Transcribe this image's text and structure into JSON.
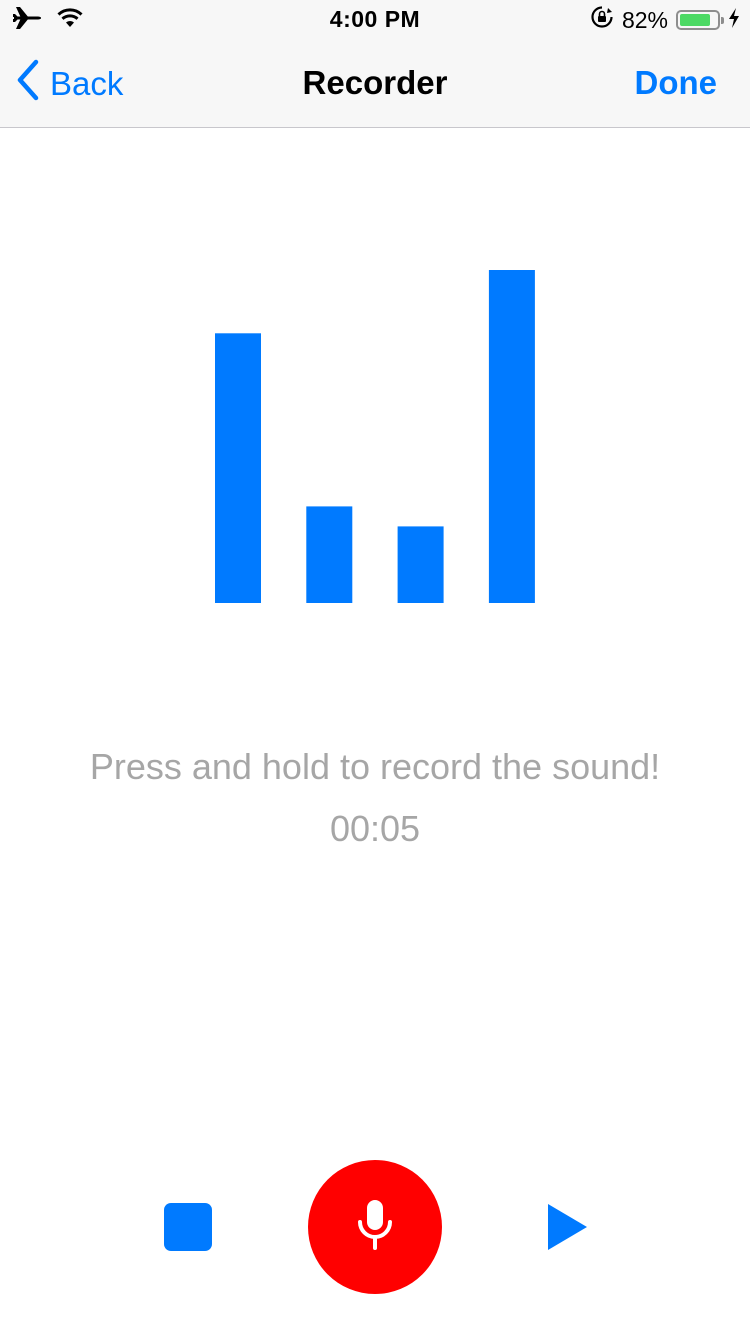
{
  "status_bar": {
    "time": "4:00 PM",
    "battery_text": "82%",
    "battery_level": 0.82,
    "icons": [
      "airplane-icon",
      "wifi-icon",
      "orientation-lock-icon",
      "battery-icon",
      "charging-bolt-icon"
    ]
  },
  "nav": {
    "back_label": "Back",
    "title": "Recorder",
    "done_label": "Done"
  },
  "level_meter": {
    "color": "#007aff",
    "levels": [
      0.81,
      0.29,
      0.23,
      1.0
    ]
  },
  "prompt": "Press and hold to record the sound!",
  "timer": "00:05",
  "controls": {
    "stop_icon": "stop-icon",
    "record_icon": "microphone-icon",
    "play_icon": "play-icon",
    "record_color": "#ff0000",
    "accent_color": "#007aff"
  }
}
